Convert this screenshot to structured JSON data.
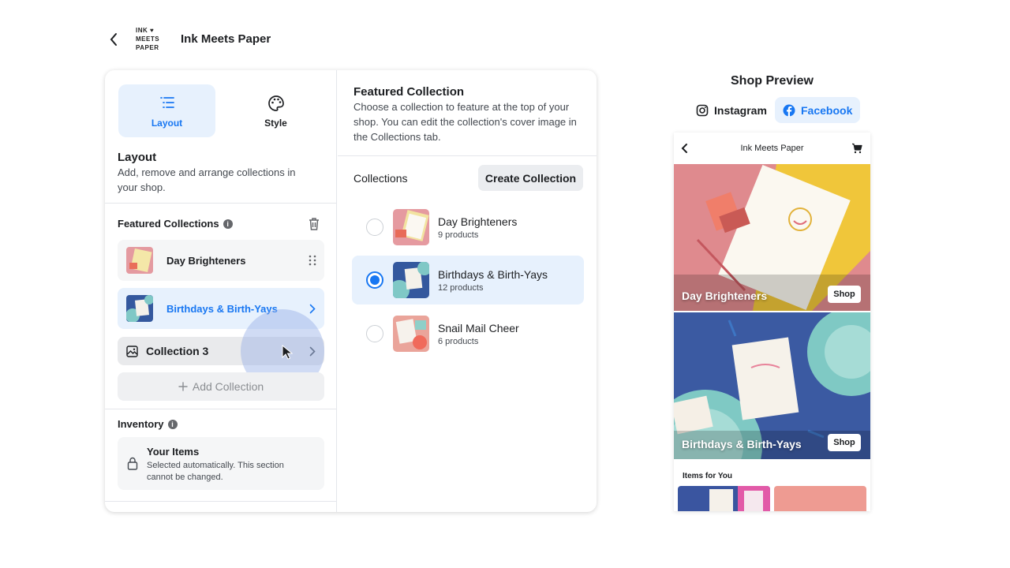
{
  "header": {
    "logo_lines": [
      "INK ♥",
      "MEETS",
      "PAPER"
    ],
    "shop_name": "Ink Meets Paper"
  },
  "tabs": {
    "layout_label": "Layout",
    "style_label": "Style"
  },
  "layout_section": {
    "title": "Layout",
    "description": "Add, remove and arrange collections in your shop."
  },
  "featured_collections": {
    "label": "Featured Collections",
    "items": [
      {
        "name": "Day Brighteners"
      },
      {
        "name": "Birthdays & Birth-Yays"
      },
      {
        "name": "Collection 3"
      }
    ],
    "add_label": "Add Collection"
  },
  "inventory": {
    "label": "Inventory",
    "title": "Your Items",
    "description": "Selected automatically. This section cannot be changed."
  },
  "featured_panel": {
    "title": "Featured Collection",
    "description": "Choose a collection to feature at the top of your shop. You can edit the collection's cover image in the Collections tab.",
    "collections_label": "Collections",
    "create_button": "Create Collection",
    "options": [
      {
        "name": "Day Brighteners",
        "count": "9 products",
        "selected": false
      },
      {
        "name": "Birthdays & Birth-Yays",
        "count": "12 products",
        "selected": true
      },
      {
        "name": "Snail Mail Cheer",
        "count": "6 products",
        "selected": false
      }
    ]
  },
  "shop_preview": {
    "title": "Shop Preview",
    "tab_instagram": "Instagram",
    "tab_facebook": "Facebook",
    "phone_title": "Ink Meets Paper",
    "hero1_label": "Day Brighteners",
    "hero2_label": "Birthdays & Birth-Yays",
    "shop_button": "Shop",
    "items_title": "Items for You"
  },
  "colors": {
    "accent": "#1877f2",
    "selected_bg": "#e7f1fd"
  }
}
